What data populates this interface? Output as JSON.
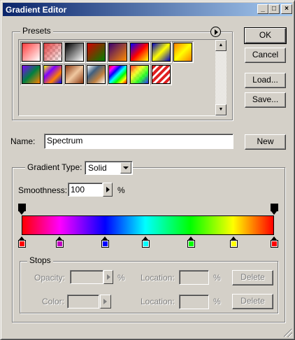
{
  "window": {
    "title": "Gradient Editor",
    "controls": {
      "minimize": "_",
      "maximize": "□",
      "close": "×"
    }
  },
  "presets": {
    "label": "Presets",
    "swatches": [
      {
        "name": "Foreground to Background",
        "bg": "linear-gradient(135deg,#ff3c3c,#fff)"
      },
      {
        "name": "Foreground to Transparent",
        "bg": "linear-gradient(135deg,#e04040,rgba(255,255,255,0)),repeating-conic-gradient(#ccc 0 25%,#fff 0 50%) 0 0/8px 8px"
      },
      {
        "name": "Black, White",
        "bg": "linear-gradient(135deg,#000,#fff)"
      },
      {
        "name": "Red, Green",
        "bg": "linear-gradient(135deg,#d40000,#008000)"
      },
      {
        "name": "Violet, Orange",
        "bg": "linear-gradient(135deg,#3a0070,#ff8c00)"
      },
      {
        "name": "Blue, Red, Yellow",
        "bg": "linear-gradient(135deg,#0000ff,#ff0000,#ffff00)"
      },
      {
        "name": "Blue, Yellow, Blue",
        "bg": "linear-gradient(135deg,#0000c8,#ffff00,#0000c8)"
      },
      {
        "name": "Orange, Yellow, Orange",
        "bg": "linear-gradient(135deg,#ff8000,#ffff00,#ff8000)"
      },
      {
        "name": "Violet, Green, Orange",
        "bg": "linear-gradient(135deg,#8000ff,#008040,#ff8000)"
      },
      {
        "name": "Yellow, Violet, Orange, Blue",
        "bg": "linear-gradient(135deg,#ffff00,#8000ff,#ff8000,#0000ff)"
      },
      {
        "name": "Copper",
        "bg": "linear-gradient(135deg,#8c3a14,#f0c8a0,#8c3a14)"
      },
      {
        "name": "Chrome",
        "bg": "linear-gradient(135deg,#ffffff,#406080,#c08040,#ffffff)"
      },
      {
        "name": "Spectrum",
        "bg": "linear-gradient(135deg,#ff0000,#ff00ff,#0000ff,#00ffff,#00ff00,#ffff00,#ff0000)"
      },
      {
        "name": "Transparent Rainbow",
        "bg": "linear-gradient(135deg,rgba(255,0,0,.8),rgba(255,255,0,.8),rgba(0,255,0,.8),rgba(0,0,255,.8)),repeating-conic-gradient(#ccc 0 25%,#fff 0 50%) 0 0/8px 8px"
      },
      {
        "name": "Transparent Stripes",
        "bg": "repeating-linear-gradient(135deg,#e02020 0 4px,#fff 4px 7px)"
      }
    ]
  },
  "buttons": {
    "ok": "OK",
    "cancel": "Cancel",
    "load": "Load...",
    "save": "Save...",
    "new": "New"
  },
  "name_field": {
    "label": "Name:",
    "value": "Spectrum"
  },
  "gradient_type": {
    "label": "Gradient Type:",
    "value": "Solid",
    "group_label": "Gradient Type:"
  },
  "smoothness": {
    "label": "Smoothness:",
    "value": "100",
    "unit": "%"
  },
  "opacity_stops": [
    0,
    100
  ],
  "color_stops": [
    {
      "pos": 0,
      "color": "#ff0000"
    },
    {
      "pos": 15,
      "color": "#c000c0"
    },
    {
      "pos": 33,
      "color": "#0000ff"
    },
    {
      "pos": 49,
      "color": "#00ffff"
    },
    {
      "pos": 67,
      "color": "#00ff00"
    },
    {
      "pos": 84,
      "color": "#ffff00"
    },
    {
      "pos": 100,
      "color": "#ff0000"
    }
  ],
  "stops": {
    "label": "Stops",
    "opacity_label": "Opacity:",
    "opacity_unit": "%",
    "color_label": "Color:",
    "location_label": "Location:",
    "location_unit": "%",
    "delete_label": "Delete"
  }
}
